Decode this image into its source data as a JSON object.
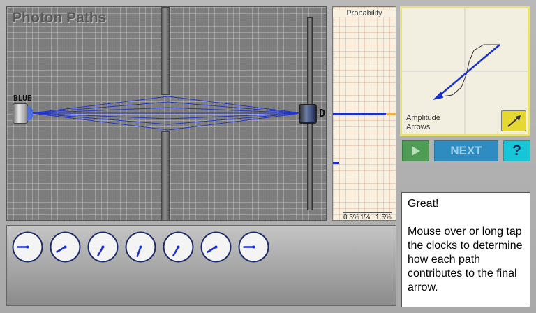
{
  "app": {
    "title": "Photon Paths"
  },
  "source": {
    "label": "BLUE",
    "color": "#1a2fd0"
  },
  "detector": {
    "label": "D"
  },
  "probability_panel": {
    "title": "Probability",
    "ticks": [
      "0.5%",
      "1%",
      "1.5%"
    ],
    "bars": [
      {
        "name": "detector-probability",
        "value_percent": 0.9
      },
      {
        "name": "small-probability",
        "value_percent": 0.12
      }
    ]
  },
  "amplitude_panel": {
    "label": "Amplitude Arrows",
    "button_icon": "arrow-icon"
  },
  "controls": {
    "play_icon": "play-icon",
    "next_label": "NEXT",
    "help_label": "?"
  },
  "message": {
    "lines": [
      "Great!",
      "Mouse over or long tap the clocks to determine how each path contributes to the final arrow."
    ]
  },
  "clocks": {
    "count": 7,
    "hand_angles_deg": [
      180,
      210,
      240,
      250,
      240,
      210,
      180
    ]
  },
  "colors": {
    "beam": "#1a2fd0",
    "accent_yellow": "#e6d833",
    "next_blue": "#2e8cc1",
    "help_cyan": "#17c6d6",
    "play_green": "#4f9c56"
  }
}
